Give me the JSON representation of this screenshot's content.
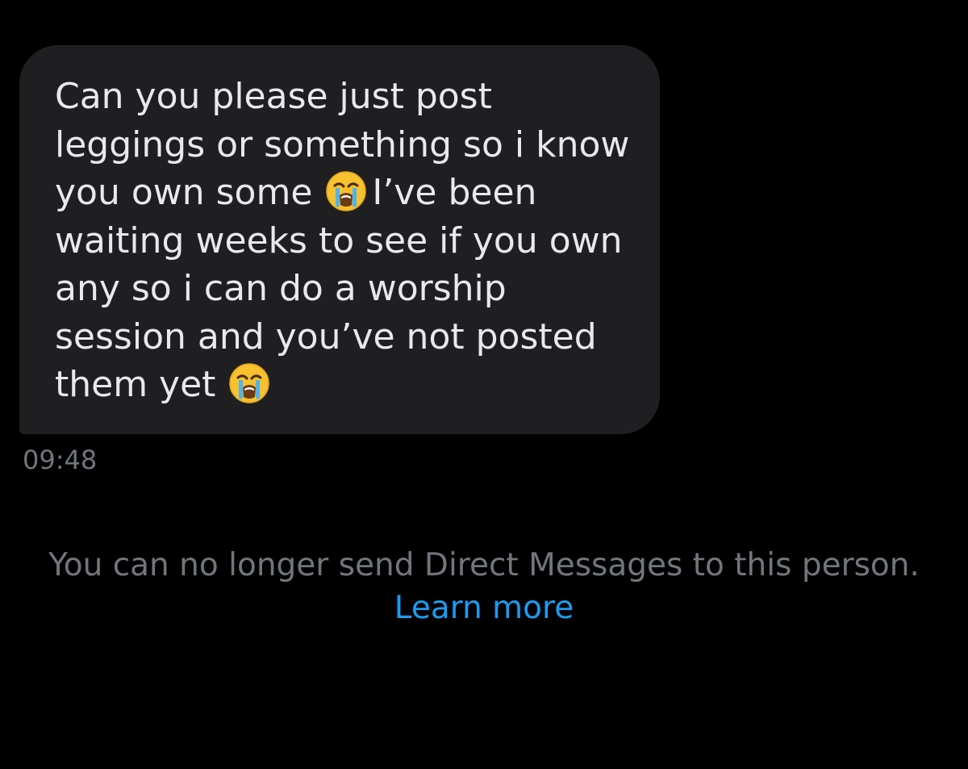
{
  "message": {
    "lines": [
      "Can you please just post",
      "leggings or something so i know",
      "you own some",
      "I’ve been",
      "waiting weeks to see if you own",
      "any so i can do a worship",
      "session and you’ve not posted",
      "them yet"
    ],
    "emoji_icon": "loudly-crying-face-icon",
    "timestamp": "09:48"
  },
  "notice": {
    "text": "You can no longer send Direct Messages to this person.",
    "link_label": "Learn more"
  },
  "colors": {
    "background": "#000000",
    "bubble": "#1f1f22",
    "message_text": "#e7e9ea",
    "muted_text": "#71767b",
    "link": "#1d9bf0"
  }
}
